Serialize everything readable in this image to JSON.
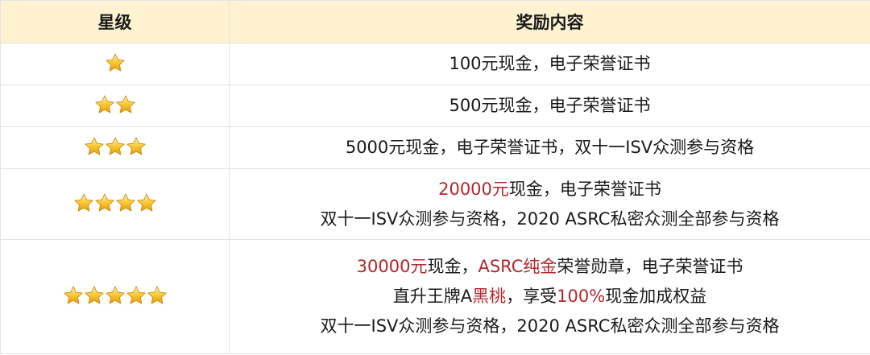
{
  "header": {
    "col_level": "星级",
    "col_reward": "奖励内容"
  },
  "colors": {
    "highlight": "#b3282d",
    "header_bg": "#fef2d0",
    "star_fill": "#f7c52b"
  },
  "rows": [
    {
      "stars": 1,
      "lines": [
        [
          {
            "t": "100元现金，电子荣誉证书",
            "h": false
          }
        ]
      ]
    },
    {
      "stars": 2,
      "lines": [
        [
          {
            "t": "500元现金，电子荣誉证书",
            "h": false
          }
        ]
      ]
    },
    {
      "stars": 3,
      "lines": [
        [
          {
            "t": "5000元现金，电子荣誉证书，双十一ISV众测参与资格",
            "h": false
          }
        ]
      ]
    },
    {
      "stars": 4,
      "lines": [
        [
          {
            "t": "20000元",
            "h": true
          },
          {
            "t": "现金，电子荣誉证书",
            "h": false
          }
        ],
        [
          {
            "t": "双十一ISV众测参与资格，2020 ASRC私密众测全部参与资格",
            "h": false
          }
        ]
      ]
    },
    {
      "stars": 5,
      "lines": [
        [
          {
            "t": "30000元",
            "h": true
          },
          {
            "t": "现金，",
            "h": false
          },
          {
            "t": "ASRC纯金",
            "h": true
          },
          {
            "t": "荣誉勋章，电子荣誉证书",
            "h": false
          }
        ],
        [
          {
            "t": "直升王牌A",
            "h": false
          },
          {
            "t": "黑桃",
            "h": true
          },
          {
            "t": "，享受",
            "h": false
          },
          {
            "t": "100%",
            "h": true
          },
          {
            "t": "现金加成权益",
            "h": false
          }
        ],
        [
          {
            "t": "双十一ISV众测参与资格，2020 ASRC私密众测全部参与资格",
            "h": false
          }
        ]
      ]
    }
  ],
  "icons": {
    "star": "star-icon"
  }
}
